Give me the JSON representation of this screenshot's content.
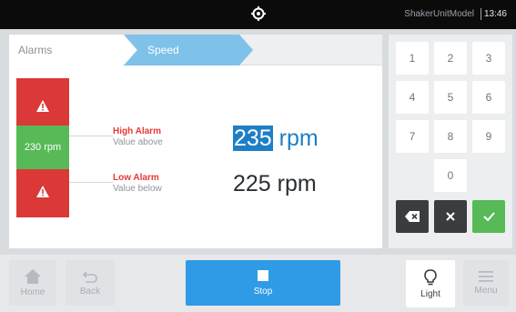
{
  "status_bar": {
    "model": "ShakerUnitModel",
    "time": "13:46"
  },
  "breadcrumb": {
    "alarms": "Alarms",
    "speed": "Speed"
  },
  "gauge": {
    "current": "230 rpm"
  },
  "high_alarm": {
    "title": "High Alarm",
    "subtitle": "Value above",
    "value": "235",
    "unit": "rpm"
  },
  "low_alarm": {
    "title": "Low Alarm",
    "subtitle": "Value below",
    "value": "225",
    "unit": "rpm"
  },
  "keypad": {
    "k1": "1",
    "k2": "2",
    "k3": "3",
    "k4": "4",
    "k5": "5",
    "k6": "6",
    "k7": "7",
    "k8": "8",
    "k9": "9",
    "k0": "0"
  },
  "bottom_bar": {
    "home": "Home",
    "back": "Back",
    "stop": "Stop",
    "light": "Light",
    "menu": "Menu"
  },
  "colors": {
    "accent": "#2f9be6",
    "alarm": "#db3838",
    "ok": "#58b957",
    "breadcrumb_active": "#7ec2e9"
  }
}
